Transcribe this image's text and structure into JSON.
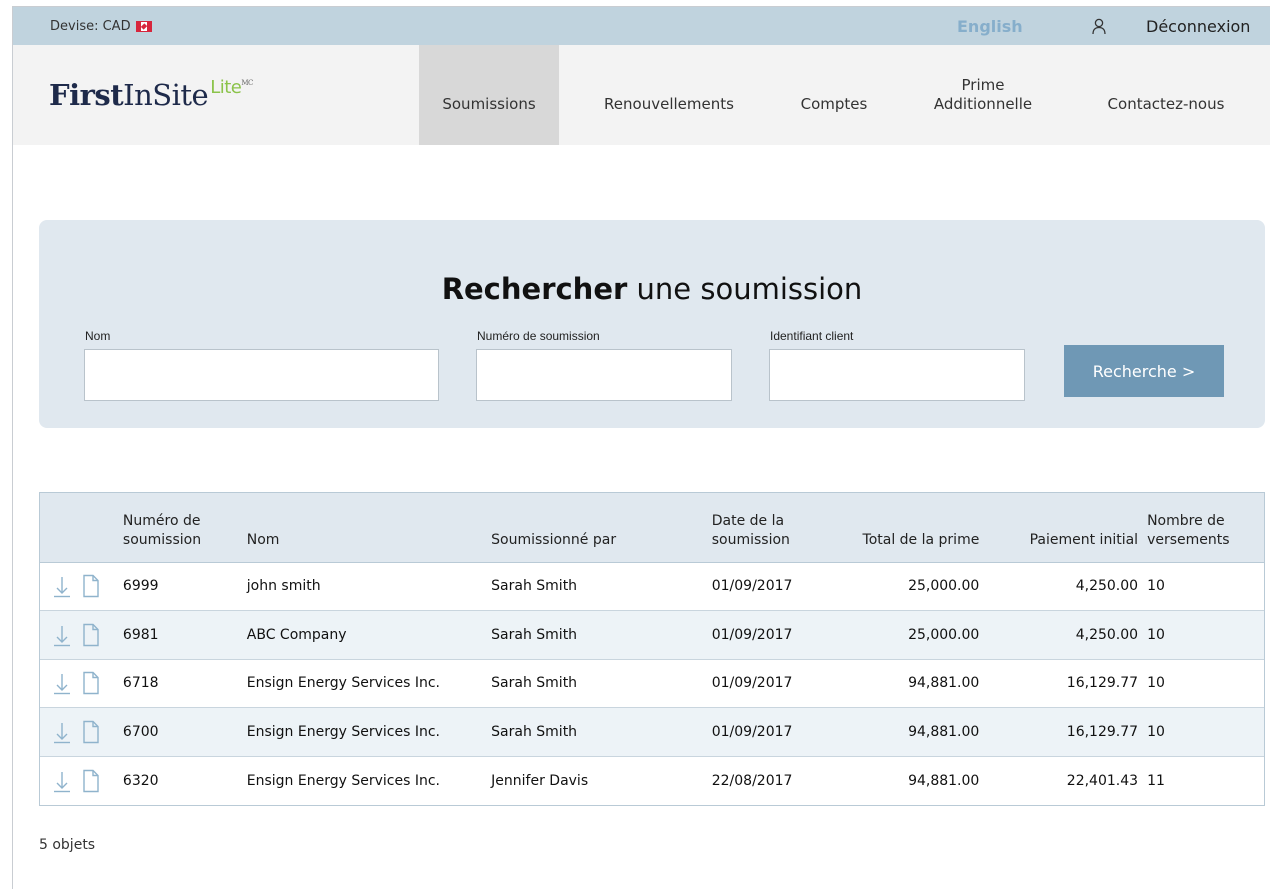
{
  "topbar": {
    "currency_label": "Devise: CAD",
    "language_link": "English",
    "logout_label": "Déconnexion"
  },
  "logo": {
    "first": "First",
    "insite": "InSite",
    "lite": "Lite",
    "mark": "MC"
  },
  "nav": {
    "items": [
      {
        "label": "Soumissions",
        "active": true
      },
      {
        "label": "Renouvellements",
        "active": false
      },
      {
        "label": "Comptes",
        "active": false
      },
      {
        "label_line1": "Prime",
        "label_line2": "Additionnelle",
        "active": false
      },
      {
        "label": "Contactez-nous",
        "active": false
      }
    ]
  },
  "search": {
    "title_bold": "Rechercher",
    "title_rest": " une soumission",
    "name_label": "Nom",
    "name_value": "",
    "submission_number_label": "Numéro de soumission",
    "submission_number_value": "",
    "client_id_label": "Identifiant client",
    "client_id_value": "",
    "button_label": "Recherche >"
  },
  "table": {
    "headers": {
      "number_line1": "Numéro de",
      "number_line2": "soumission",
      "name": "Nom",
      "submitted_by": "Soumissionné par",
      "date_line1": "Date de la",
      "date_line2": "soumission",
      "total_premium": "Total de la prime",
      "initial_payment": "Paiement initial",
      "installments_line1": "Nombre de",
      "installments_line2": "versements"
    },
    "rows": [
      {
        "number": "6999",
        "name": "john smith",
        "submitted_by": "Sarah Smith",
        "date": "01/09/2017",
        "total": "25,000.00",
        "initial": "4,250.00",
        "installments": "10"
      },
      {
        "number": "6981",
        "name": "ABC Company",
        "submitted_by": "Sarah Smith",
        "date": "01/09/2017",
        "total": "25,000.00",
        "initial": "4,250.00",
        "installments": "10"
      },
      {
        "number": "6718",
        "name": "Ensign Energy Services Inc.",
        "submitted_by": "Sarah Smith",
        "date": "01/09/2017",
        "total": "94,881.00",
        "initial": "16,129.77",
        "installments": "10"
      },
      {
        "number": "6700",
        "name": "Ensign Energy Services Inc.",
        "submitted_by": "Sarah Smith",
        "date": "01/09/2017",
        "total": "94,881.00",
        "initial": "16,129.77",
        "installments": "10"
      },
      {
        "number": "6320",
        "name": "Ensign Energy Services Inc.",
        "submitted_by": "Jennifer Davis",
        "date": "22/08/2017",
        "total": "94,881.00",
        "initial": "22,401.43",
        "installments": "11"
      }
    ]
  },
  "footer": {
    "item_count": "5 objets"
  },
  "colors": {
    "topbar_bg": "#c0d3de",
    "panel_bg": "#e0e8ef",
    "button_bg": "#6f98b5",
    "language_link": "#86aecb",
    "logo_lite": "#8bc34a",
    "icon_color": "#8fb3cc"
  },
  "icons": {
    "flag": "canada-flag-icon",
    "user": "user-icon",
    "download": "download-icon",
    "document": "document-icon"
  }
}
